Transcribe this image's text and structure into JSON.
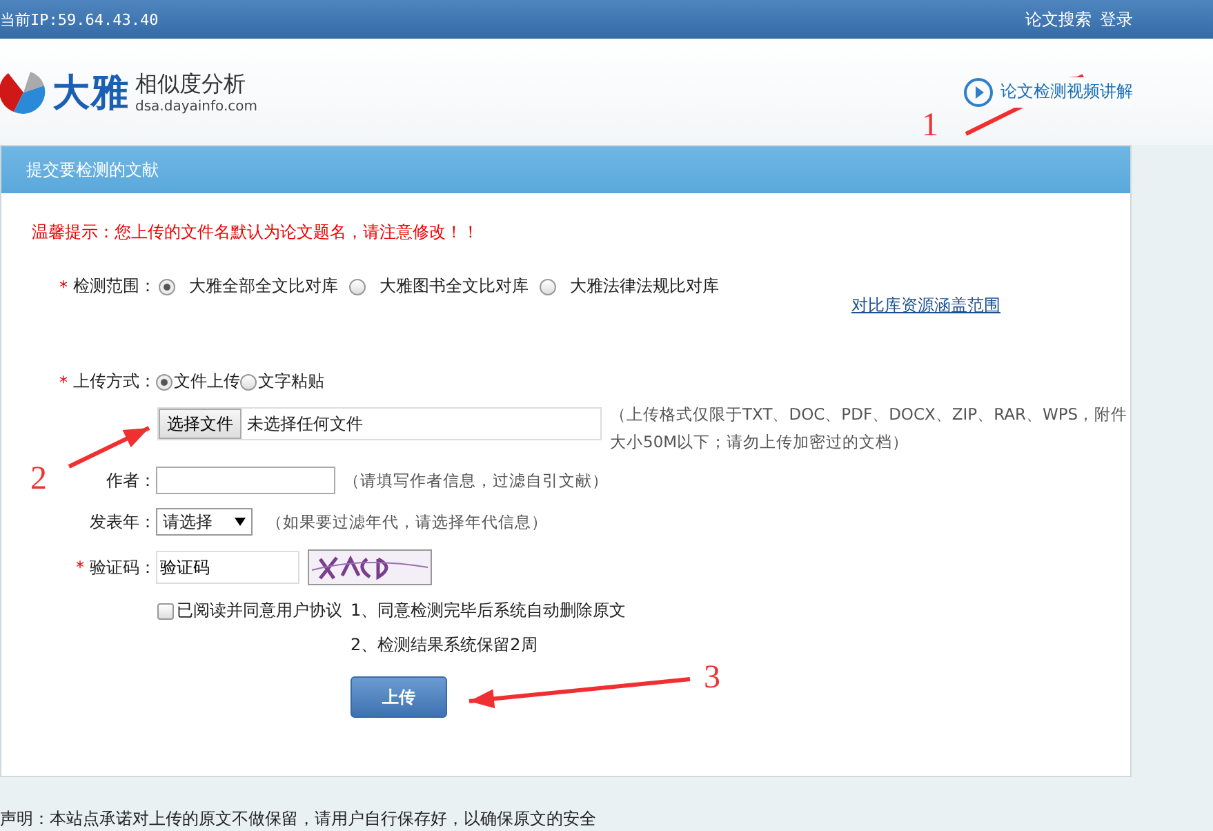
{
  "top_bar": {
    "ip": "当前IP:59.64.43.40",
    "links": [
      "论文搜索",
      "登录"
    ]
  },
  "header": {
    "logo_name": "大雅",
    "logo_title": "相似度分析",
    "logo_url": "dsa.dayainfo.com",
    "video_link": "论文检测视频讲解"
  },
  "panel": {
    "title": "提交要检测的文献",
    "notice": "温馨提示：您上传的文件名默认为论文题名，请注意修改！！",
    "scope": {
      "label": "检测范围：",
      "required_mark": "*",
      "options": [
        {
          "label": "大雅全部全文比对库",
          "selected": true
        },
        {
          "label": "大雅图书全文比对库",
          "selected": false
        },
        {
          "label": "大雅法律法规比对库",
          "selected": false
        }
      ],
      "link": "对比库资源涵盖范围"
    },
    "method": {
      "label": "上传方式：",
      "required_mark": "*",
      "options": [
        {
          "label": "文件上传",
          "selected": true
        },
        {
          "label": "文字粘贴",
          "selected": false
        }
      ]
    },
    "file": {
      "button": "选择文件",
      "status": "未选择任何文件",
      "hint_lines": [
        "（上传格式仅限于TXT、DOC、PDF、DOCX、ZIP、RAR、WPS，附件",
        "大小50M以下；请勿上传加密过的文档）"
      ]
    },
    "author": {
      "label": "作者：",
      "hint": "（请填写作者信息，过滤自引文献）"
    },
    "year": {
      "label": "发表年：",
      "value": "请选择",
      "hint": "（如果要过滤年代，请选择年代信息）"
    },
    "captcha": {
      "label": "验证码：",
      "required_mark": "*",
      "value": "验证码"
    },
    "agreement": {
      "label": "已阅读并同意用户协议",
      "checked": false,
      "notes": [
        "1、同意检测完毕后系统自动删除原文",
        "2、检测结果系统保留2周"
      ]
    },
    "submit": "上传"
  },
  "footer": "声明：本站点承诺对上传的原文不做保留，请用户自行保存好，以确保原文的安全",
  "annotations": [
    {
      "number": "1"
    },
    {
      "number": "2"
    },
    {
      "number": "3"
    }
  ]
}
